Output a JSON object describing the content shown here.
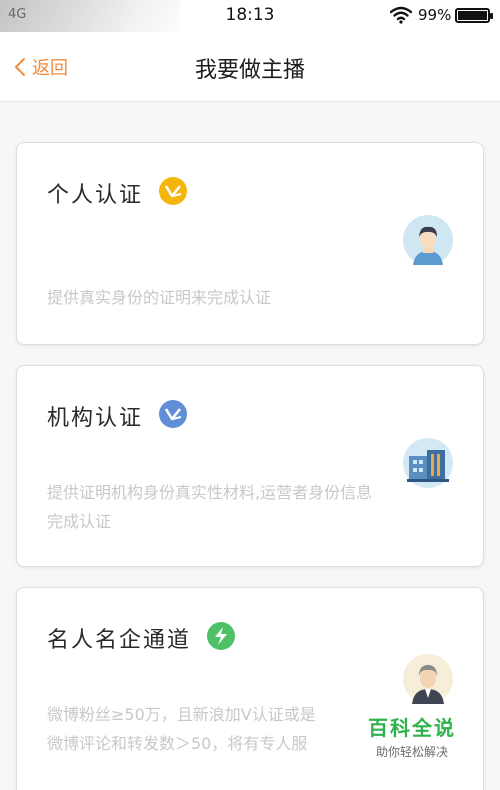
{
  "status_bar": {
    "carrier": "4G",
    "time": "18:13",
    "battery_pct": "99%",
    "battery_level": 0.99
  },
  "nav": {
    "back_label": "返回",
    "title": "我要做主播"
  },
  "cards": [
    {
      "title": "个人认证",
      "badge_color": "#f5b50b",
      "description": "提供真实身份的证明来完成认证",
      "icon": "person-avatar-icon"
    },
    {
      "title": "机构认证",
      "badge_color": "#5f8ed6",
      "description": "提供证明机构身份真实性材料,运营者身份信息完成认证",
      "icon": "building-icon"
    },
    {
      "title": "名人名企通道",
      "badge_color": "#4fc065",
      "description": "微博粉丝≥50万，且新浪加V认证或是\n微博评论和转发数＞50，将有专人服",
      "icon": "businessman-avatar-icon"
    }
  ],
  "watermark": {
    "title": "百科全说",
    "subtitle": "助你轻松解决"
  }
}
